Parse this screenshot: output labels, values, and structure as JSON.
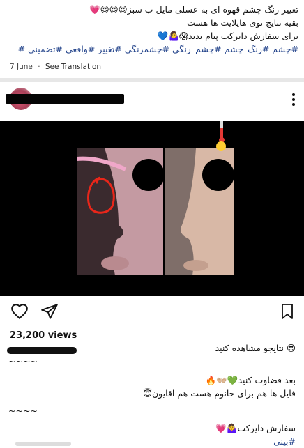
{
  "caption_top": {
    "line1": "تغییر رنگ چشم قهوه ای به عسلی مایل ب سبز😍😍😍💗",
    "line2": "بقیه نتایج توی هایلایت ها هست",
    "line3": "برای سفارش دایرکت پیام بدید😱🤷‍♀️💙",
    "hashtags": "#چشم #رنگ_چشم #چشم_رنگی #چشمرنگی #تغییر #واقعی #تضمینی #"
  },
  "meta": {
    "date": "7 June",
    "separator": "·",
    "see_translation": "See Translation"
  },
  "post": {
    "views": "23,200 views",
    "caption_lines": [
      "😍 نتایجو مشاهده کنید",
      "~~~~",
      "بعد قضاوت کنید💚👐🏼🔥",
      "فایل ها هم برای خانوم هست هم اقایون😇",
      "~~~~",
      "سفارش دایرکت🤷‍♀️💗",
      "#بینی"
    ]
  },
  "colors": {
    "hashtag": "#27478d",
    "media_bg": "#000000",
    "annotation_red": "#e8261a"
  },
  "icons": {
    "like": "heart-icon",
    "share": "send-icon",
    "save": "bookmark-icon",
    "more": "more-vertical-icon"
  }
}
